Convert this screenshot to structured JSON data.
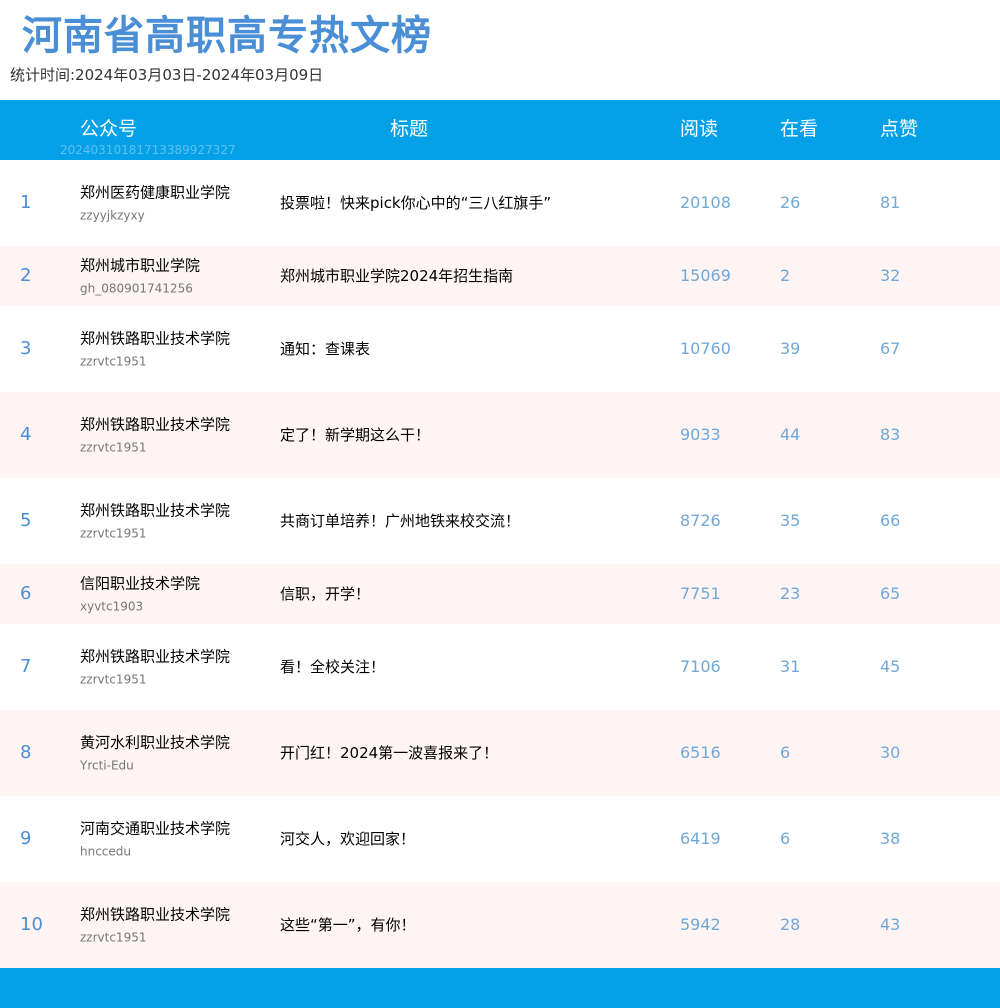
{
  "title": "河南省高职高专热文榜",
  "period": "统计时间:2024年03月03日-2024年03月09日",
  "colors": {
    "title": "#4a8fd6",
    "header_bg": "#05a1e8",
    "alt_row_bg": "#fff4f4",
    "number_text": "#6fa8d8"
  },
  "table": {
    "headers": {
      "account": "公众号",
      "title": "标题",
      "read": "阅读",
      "watching": "在看",
      "likes": "点赞"
    },
    "header_watermark": "20240310181713389927327",
    "rows": [
      {
        "rank": "1",
        "account": "郑州医药健康职业学院",
        "account_id": "zzyyjkzyxy",
        "title": "投票啦！快来pick你心中的“三八红旗手”",
        "read": "20108",
        "watching": "26",
        "likes": "81"
      },
      {
        "rank": "2",
        "account": "郑州城市职业学院",
        "account_id": "gh_080901741256",
        "title": "郑州城市职业学院2024年招生指南",
        "read": "15069",
        "watching": "2",
        "likes": "32"
      },
      {
        "rank": "3",
        "account": "郑州铁路职业技术学院",
        "account_id": "zzrvtc1951",
        "title": "通知：查课表",
        "read": "10760",
        "watching": "39",
        "likes": "67"
      },
      {
        "rank": "4",
        "account": "郑州铁路职业技术学院",
        "account_id": "zzrvtc1951",
        "title": "定了！新学期这么干！",
        "read": "9033",
        "watching": "44",
        "likes": "83"
      },
      {
        "rank": "5",
        "account": "郑州铁路职业技术学院",
        "account_id": "zzrvtc1951",
        "title": "共商订单培养！广州地铁来校交流！",
        "read": "8726",
        "watching": "35",
        "likes": "66"
      },
      {
        "rank": "6",
        "account": "信阳职业技术学院",
        "account_id": "xyvtc1903",
        "title": "信职，开学！",
        "read": "7751",
        "watching": "23",
        "likes": "65"
      },
      {
        "rank": "7",
        "account": "郑州铁路职业技术学院",
        "account_id": "zzrvtc1951",
        "title": "看！全校关注！",
        "read": "7106",
        "watching": "31",
        "likes": "45"
      },
      {
        "rank": "8",
        "account": "黄河水利职业技术学院",
        "account_id": "Yrcti-Edu",
        "title": "开门红！2024第一波喜报来了！",
        "read": "6516",
        "watching": "6",
        "likes": "30"
      },
      {
        "rank": "9",
        "account": "河南交通职业技术学院",
        "account_id": "hnccedu",
        "title": "河交人，欢迎回家！",
        "read": "6419",
        "watching": "6",
        "likes": "38"
      },
      {
        "rank": "10",
        "account": "郑州铁路职业技术学院",
        "account_id": "zzrvtc1951",
        "title": "这些“第一”，有你！",
        "read": "5942",
        "watching": "28",
        "likes": "43"
      }
    ]
  }
}
